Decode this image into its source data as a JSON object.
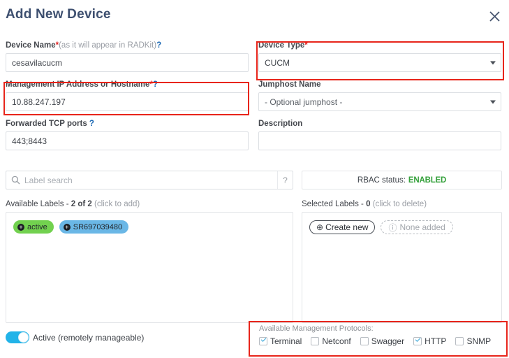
{
  "dialog": {
    "title": "Add New Device",
    "close_icon": "close-icon"
  },
  "fields": {
    "device_name": {
      "label": "Device Name",
      "required_mark": "*",
      "hint": "(as it will appear in RADKit)",
      "help_mark": "?",
      "value": "cesavilacucm",
      "placeholder": ""
    },
    "management_ip": {
      "label": "Management IP Address or Hostname",
      "required_mark": "*",
      "help_mark": "?",
      "value": "10.88.247.197",
      "placeholder": ""
    },
    "forwarded_ports": {
      "label": "Forwarded TCP ports",
      "help_mark": "?",
      "value": "443;8443",
      "placeholder": ""
    },
    "device_type": {
      "label": "Device Type",
      "required_mark": "*",
      "value": "CUCM",
      "options": [
        "CUCM"
      ]
    },
    "jumphost_name": {
      "label": "Jumphost Name",
      "value": "- Optional jumphost -",
      "options": [
        "- Optional jumphost -"
      ]
    },
    "description": {
      "label": "Description",
      "value": "",
      "placeholder": ""
    }
  },
  "label_search": {
    "placeholder": "Label search",
    "value": "",
    "search_icon": "search-icon",
    "help_mark": "?"
  },
  "rbac": {
    "label": "RBAC status:",
    "value": "ENABLED",
    "value_color": "#35a13c"
  },
  "available_labels": {
    "title": "Available Labels -",
    "count": "2 of 2",
    "action_hint": "(click to add)",
    "chips": [
      {
        "text": "active",
        "color": "#72d14f",
        "add_icon": "plus-circle-icon"
      },
      {
        "text": "SR697039480",
        "color": "#6ab7e6",
        "add_icon": "plus-circle-icon"
      }
    ]
  },
  "selected_labels": {
    "title": "Selected Labels -",
    "count": "0",
    "action_hint": "(click to delete)",
    "create_new_label": "Create new",
    "create_new_icon": "plus-circle-icon",
    "empty_label": "None added",
    "empty_icon": "info-circle-icon"
  },
  "footer": {
    "active_toggle": {
      "label": "Active (remotely manageable)",
      "state": "on",
      "accent_color": "#22b3e8"
    },
    "protocols": {
      "title": "Available Management Protocols:",
      "items": [
        {
          "label": "Terminal",
          "checked": true
        },
        {
          "label": "Netconf",
          "checked": false
        },
        {
          "label": "Swagger",
          "checked": false
        },
        {
          "label": "HTTP",
          "checked": true
        },
        {
          "label": "SNMP",
          "checked": false
        }
      ]
    }
  },
  "annotations": {
    "color": "#e8251b",
    "boxes": [
      {
        "name": "management-ip-highlight"
      },
      {
        "name": "device-type-highlight"
      },
      {
        "name": "protocols-highlight"
      }
    ]
  }
}
